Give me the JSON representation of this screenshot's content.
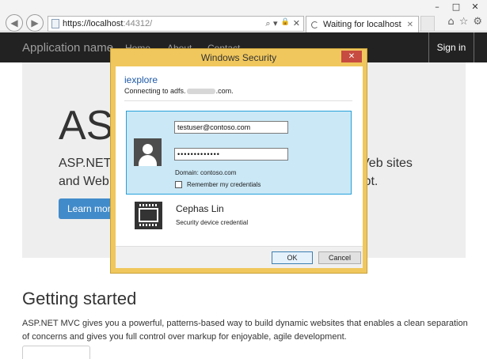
{
  "browser": {
    "url_host": "https://localhost",
    "url_port": ":44312/",
    "tab_title": "Waiting for localhost",
    "window_buttons": [
      "–",
      "□",
      "✕"
    ],
    "nav_back_icon": "◀",
    "nav_forward_icon": "▶",
    "search_glyph": "⌕ ▾",
    "lock_glyph": "🔒",
    "stop_glyph": "✕",
    "tab_close_glyph": "✕",
    "tool_icons": [
      "⌂",
      "☆",
      "⚙"
    ]
  },
  "site": {
    "brand": "Application name",
    "nav": [
      "Home",
      "About",
      "Contact"
    ],
    "signin": "Sign in",
    "jumbo_title": "AS",
    "lead_left": "ASP.NET\nand Web",
    "lead_right": "Veb sites\nipt.",
    "learn_more": "Learn more",
    "getting_started": "Getting started",
    "paragraph": "ASP.NET MVC gives you a powerful, patterns-based way to build dynamic websites that enables a clean separation of concerns and gives you full control over markup for enjoyable, agile development."
  },
  "dialog": {
    "title": "Windows Security",
    "close_glyph": "✕",
    "app_name": "iexplore",
    "connecting_prefix": "Connecting to adfs.",
    "connecting_suffix": ".com.",
    "username": "testuser@contoso.com",
    "password_mask": "•••••••••••••",
    "domain": "Domain: contoso.com",
    "remember": "Remember my credentials",
    "other_credential_name": "Cephas Lin",
    "other_credential_sub": "Security device credential",
    "ok": "OK",
    "cancel": "Cancel"
  }
}
